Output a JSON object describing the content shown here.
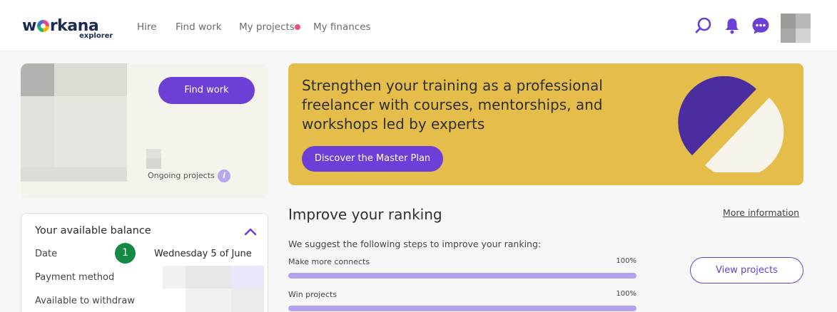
{
  "header": {
    "logo_main_pre": "w",
    "logo_main_post": "rkana",
    "logo_sub": "explorer",
    "nav": [
      "Hire",
      "Find work",
      "My projects",
      "My finances"
    ]
  },
  "profile": {
    "find_work_label": "Find work",
    "ongoing_label": "Ongoing projects",
    "info_glyph": "i"
  },
  "balance": {
    "title": "Your available balance",
    "date_label": "Date",
    "date_value": "Wednesday 5 of June",
    "payment_label": "Payment method",
    "withdraw_label": "Available to withdraw",
    "step_badge": "1"
  },
  "promo": {
    "text": "Strengthen your training as a professional freelancer with courses, mentorships, and workshops led by experts",
    "button": "Discover the Master Plan"
  },
  "ranking": {
    "title": "Improve your ranking",
    "more_info": "More information",
    "suggest": "We suggest the following steps to improve your ranking:",
    "steps": [
      {
        "label": "Make more connects",
        "pct_text": "100%",
        "progress": 1.0
      },
      {
        "label": "Win projects",
        "pct_text": "100%",
        "progress": 1.0
      }
    ],
    "view_projects": "View projects"
  },
  "colors": {
    "accent": "#6c3fd7",
    "promo_bg": "#e4bd4a",
    "badge_green": "#138a43",
    "nav_dot": "#ee4b8a"
  },
  "icons": [
    "search-icon",
    "bell-icon",
    "chat-icon",
    "chevron-up-icon",
    "info-icon"
  ]
}
